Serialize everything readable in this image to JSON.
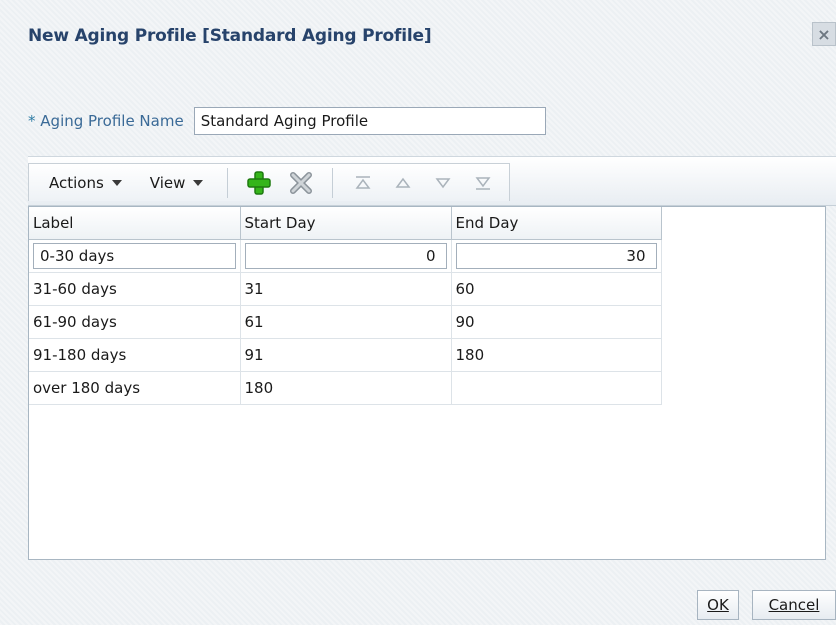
{
  "dialog": {
    "title": "New Aging Profile [Standard Aging Profile]"
  },
  "form": {
    "required_marker": "*",
    "name_label": "Aging Profile Name",
    "name_value": "Standard Aging Profile"
  },
  "toolbar": {
    "actions_label": "Actions",
    "view_label": "View",
    "icons": [
      "add-icon",
      "delete-icon",
      "move-top-icon",
      "move-up-icon",
      "move-down-icon",
      "move-bottom-icon"
    ]
  },
  "table": {
    "headers": [
      "Label",
      "Start Day",
      "End Day"
    ],
    "rows": [
      {
        "label": "0-30 days",
        "start": "0",
        "end": "30"
      },
      {
        "label": "31-60 days",
        "start": "31",
        "end": "60"
      },
      {
        "label": "61-90 days",
        "start": "61",
        "end": "90"
      },
      {
        "label": "91-180 days",
        "start": "91",
        "end": "180"
      },
      {
        "label": "over 180 days",
        "start": "180",
        "end": ""
      }
    ]
  },
  "buttons": {
    "ok": "OK",
    "cancel": "Cancel"
  },
  "colors": {
    "title": "#27436b",
    "label": "#3a6a97",
    "add_icon": "#35b51a"
  }
}
